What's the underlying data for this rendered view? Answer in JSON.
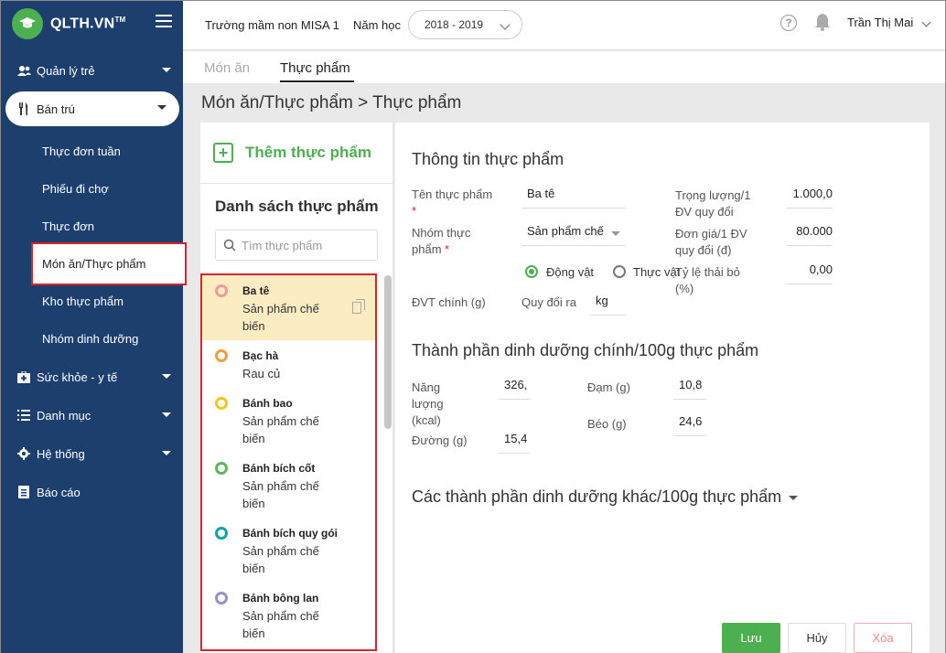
{
  "sidebar": {
    "logo": "QLTH.VN",
    "logo_tm": "TM",
    "menu": [
      {
        "label": "Quản lý trẻ"
      },
      {
        "label": "Bán trú"
      },
      {
        "label": "Sức khỏe - y tế"
      },
      {
        "label": "Danh mục"
      },
      {
        "label": "Hệ thống"
      },
      {
        "label": "Báo cáo"
      }
    ],
    "submenu": [
      {
        "label": "Thực đơn tuần"
      },
      {
        "label": "Phiếu đi chợ"
      },
      {
        "label": "Thực đơn"
      },
      {
        "label": "Món ăn/Thực phẩm"
      },
      {
        "label": "Kho thực phẩm"
      },
      {
        "label": "Nhóm dinh dưỡng"
      }
    ]
  },
  "header": {
    "school": "Trường mầm non MISA 1",
    "year_label": "Năm học",
    "year_value": "2018 - 2019",
    "help": "?",
    "user": "Trần Thị Mai"
  },
  "tabs": [
    {
      "label": "Món ăn"
    },
    {
      "label": "Thực phẩm"
    }
  ],
  "breadcrumb": "Món ăn/Thực phẩm > Thực phẩm",
  "list": {
    "add_label": "Thêm thực phẩm",
    "add_icon_text": "+",
    "title": "Danh sách thực phẩm",
    "search_placeholder": "Tìm thực phẩm",
    "items": [
      {
        "name": "Ba tê",
        "group": "Sản phẩm chế biến",
        "color": "#ef9a9a"
      },
      {
        "name": "Bạc hà",
        "group": "Rau củ",
        "color": "#f39c3c"
      },
      {
        "name": "Bánh bao",
        "group": "Sản phẩm chế biến",
        "color": "#f5c518"
      },
      {
        "name": "Bánh bích cốt",
        "group": "Sản phẩm chế biến",
        "color": "#5cb85c"
      },
      {
        "name": "Bánh bích quy gói",
        "group": "Sản phẩm chế biến",
        "color": "#0aa6a6"
      },
      {
        "name": "Bánh bông lan",
        "group": "Sản phẩm chế biến",
        "color": "#9b8fc9"
      }
    ]
  },
  "detail": {
    "info_title": "Thông tin thực phẩm",
    "name_label": "Tên thực phẩm",
    "req": "*",
    "name_value": "Ba tê",
    "group_label": "Nhóm thực phẩm",
    "group_value": "Sản phẩm chế",
    "radio_animal": "Động vật",
    "radio_plant": "Thực vật",
    "unit_label": "ĐVT chính (g)",
    "convert_label": "Quy đổi ra",
    "convert_value": "kg",
    "weight_label": "Trọng lượng/1 ĐV quy đổi",
    "weight_value": "1.000,0",
    "price_label": "Đơn giá/1 ĐV quy đổi (đ)",
    "price_value": "80.000",
    "waste_label": "Tỷ lệ thải bỏ (%)",
    "waste_value": "0,00",
    "nutri_title": "Thành phần dinh dưỡng chính/100g thực phẩm",
    "energy_label": "Năng lượng (kcal)",
    "energy_value": "326,",
    "sugar_label": "Đường (g)",
    "sugar_value": "15,4",
    "protein_label": "Đạm (g)",
    "protein_value": "10,8",
    "fat_label": "Béo (g)",
    "fat_value": "24,6",
    "other_title": "Các thành phần dinh dưỡng khác/100g thực phẩm",
    "save": "Lưu",
    "cancel": "Hủy",
    "delete": "Xóa"
  }
}
